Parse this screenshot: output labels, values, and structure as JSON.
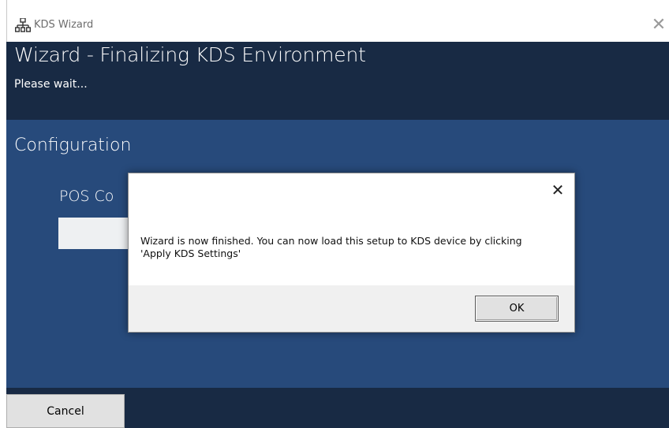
{
  "window": {
    "title": "KDS Wizard",
    "icon": "network-icon",
    "close_glyph": "✕"
  },
  "header": {
    "title": "Wizard - Finalizing KDS Environment",
    "subtitle": "Please wait..."
  },
  "content": {
    "section_title": "Configuration",
    "pos_label_partial": "POS Co"
  },
  "footer": {
    "cancel_label": "Cancel"
  },
  "dialog": {
    "close_glyph": "✕",
    "message": "Wizard is now finished. You can now load this setup to KDS device by clicking 'Apply KDS Settings'",
    "ok_label": "OK"
  },
  "colors": {
    "header_bg": "#182a44",
    "content_bg": "#274a7b"
  }
}
